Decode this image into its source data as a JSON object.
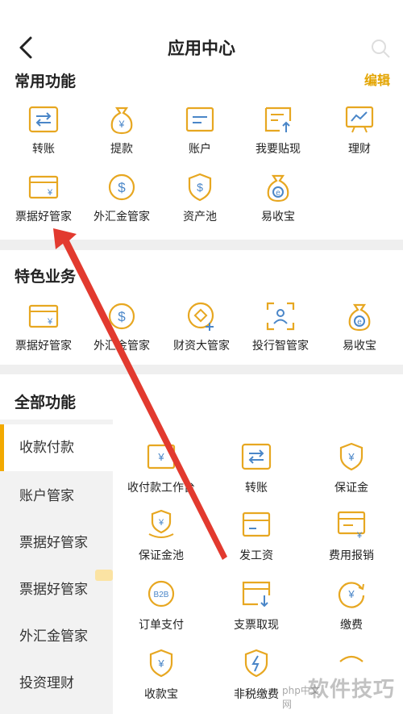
{
  "header": {
    "title": "应用中心"
  },
  "common": {
    "title": "常用功能",
    "edit": "编辑",
    "items": [
      "转账",
      "提款",
      "账户",
      "我要贴现",
      "理财",
      "票据好管家",
      "外汇金管家",
      "资产池",
      "易收宝"
    ]
  },
  "featured": {
    "title": "特色业务",
    "items": [
      "票据好管家",
      "外汇金管家",
      "财资大管家",
      "投行智管家",
      "易收宝"
    ]
  },
  "all": {
    "title": "全部功能",
    "sidebar": [
      "收款付款",
      "账户管家",
      "票据好管家",
      "票据好管家",
      "外汇金管家",
      "投资理财"
    ],
    "grid": [
      "收付款工作台",
      "转账",
      "保证金",
      "保证金池",
      "发工资",
      "费用报销",
      "订单支付",
      "支票取现",
      "缴费",
      "收款宝",
      "非税缴费",
      ""
    ]
  },
  "watermark": {
    "text": "软件技巧",
    "logo": "php中文网"
  },
  "colors": {
    "accent": "#f2a900",
    "icon": "#e7a721",
    "icon_blue": "#4a86c8",
    "arrow": "#e23a2f"
  }
}
